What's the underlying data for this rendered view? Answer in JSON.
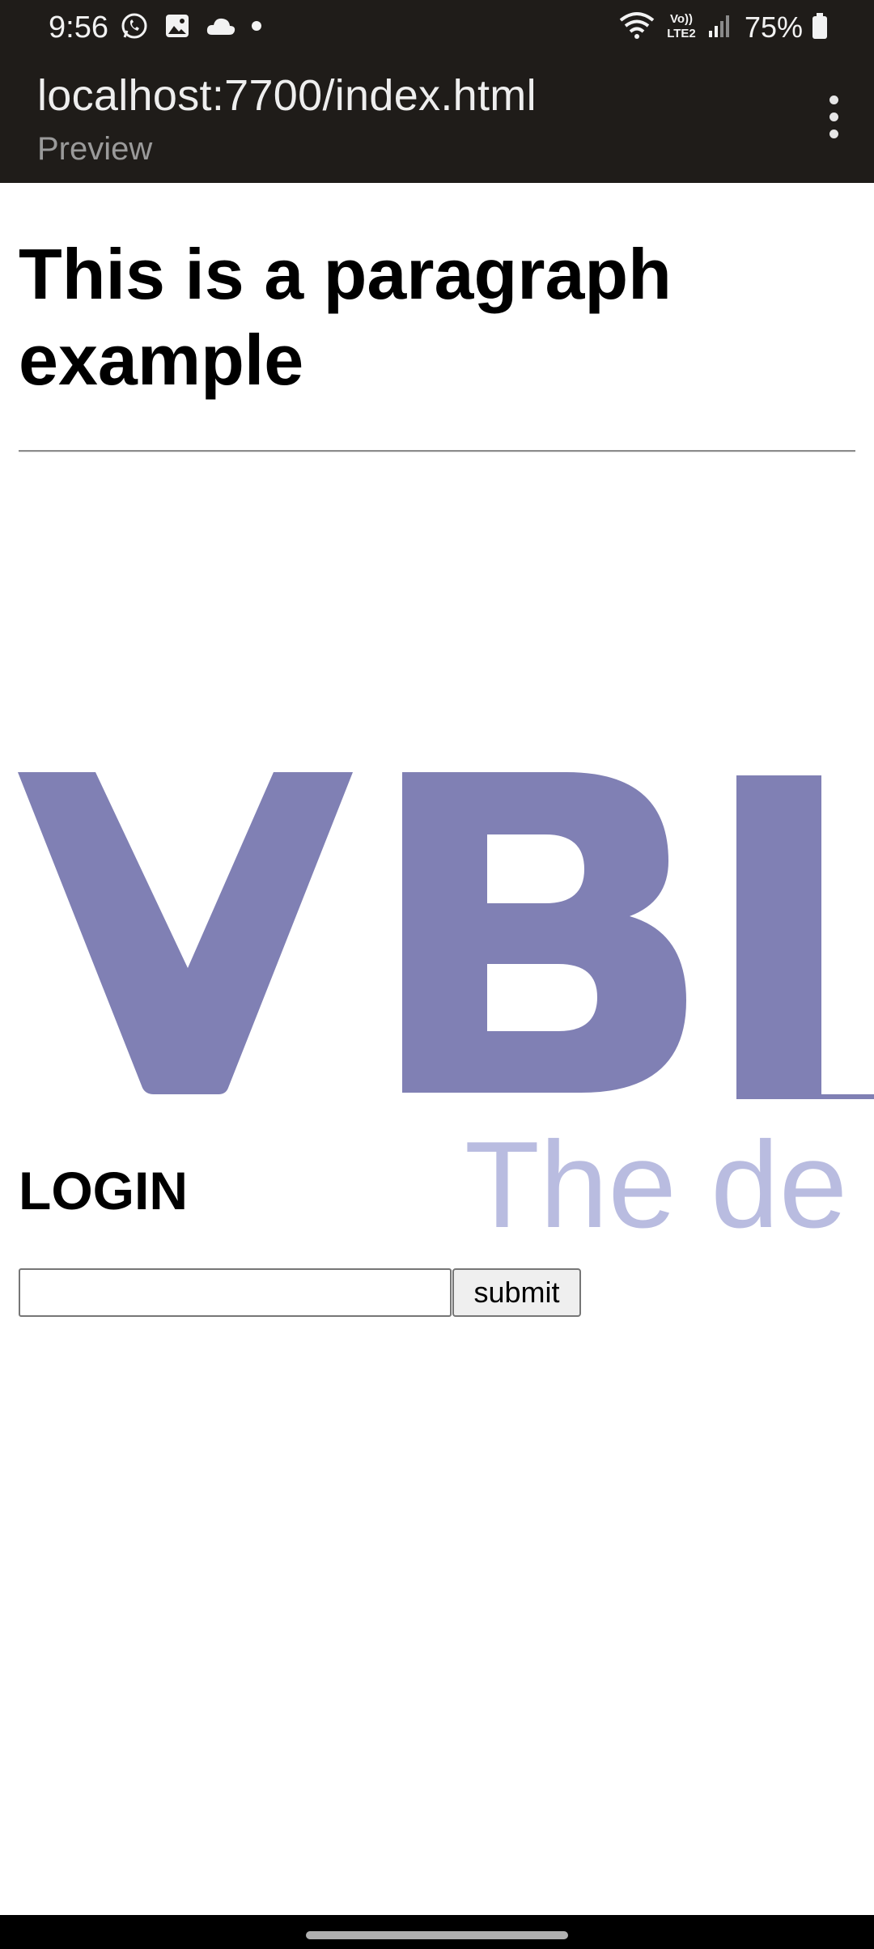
{
  "status_bar": {
    "time": "9:56",
    "battery_percent": "75%",
    "network_label": "VoLTE2",
    "icons_left": [
      "whatsapp-icon",
      "gallery-icon",
      "cloud-icon",
      "dot-icon"
    ],
    "icons_right": [
      "wifi-icon",
      "volte-icon",
      "signal-icon",
      "battery-icon"
    ]
  },
  "browser": {
    "url": "localhost:7700/index.html",
    "subtitle": "Preview",
    "menu_icon": "more-vertical-icon"
  },
  "page": {
    "heading": "This is a paragraph example",
    "logo": {
      "text": "VBL",
      "tagline": "The de",
      "logo_color": "#8080b4",
      "tagline_color": "#b9bce0"
    },
    "login": {
      "heading": "LOGIN",
      "input_value": "",
      "submit_label": "submit"
    }
  }
}
